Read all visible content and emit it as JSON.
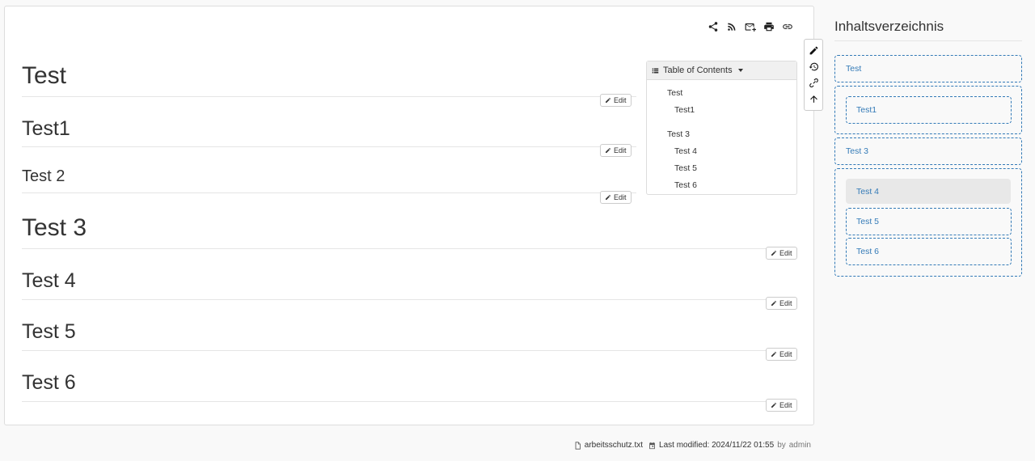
{
  "page_tools": [
    {
      "icon": "share-icon"
    },
    {
      "icon": "rss-icon"
    },
    {
      "icon": "mail-add-icon"
    },
    {
      "icon": "print-icon"
    },
    {
      "icon": "link-icon"
    }
  ],
  "side_tools": [
    {
      "icon": "pencil-icon"
    },
    {
      "icon": "history-icon"
    },
    {
      "icon": "backlink-icon"
    },
    {
      "icon": "arrow-up-icon"
    }
  ],
  "headings": [
    {
      "text": "Test",
      "level": 1
    },
    {
      "text": "Test1",
      "level": 2
    },
    {
      "text": "Test 2",
      "level": 3
    },
    {
      "text": "Test 3",
      "level": 1
    },
    {
      "text": "Test 4",
      "level": 2
    },
    {
      "text": "Test 5",
      "level": 2
    },
    {
      "text": "Test 6",
      "level": 2
    }
  ],
  "edit_label": "Edit",
  "toc": {
    "title": "Table of Contents",
    "items": [
      "Test",
      "Test1",
      "Test 3",
      "Test 4",
      "Test 5",
      "Test 6"
    ]
  },
  "sidebar": {
    "title": "Inhaltsverzeichnis",
    "items": [
      "Test",
      "Test1",
      "Test 3",
      "Test 4",
      "Test 5",
      "Test 6"
    ],
    "active": "Test 4"
  },
  "footer": {
    "filename": "arbeitsschutz.txt",
    "modified_label": "Last modified: 2024/11/22 01:55",
    "by_label": "by",
    "author": "admin"
  },
  "colors": {
    "link": "#337ab7",
    "border_dashed": "#337ab7",
    "active_bg": "#e8e8e8"
  }
}
